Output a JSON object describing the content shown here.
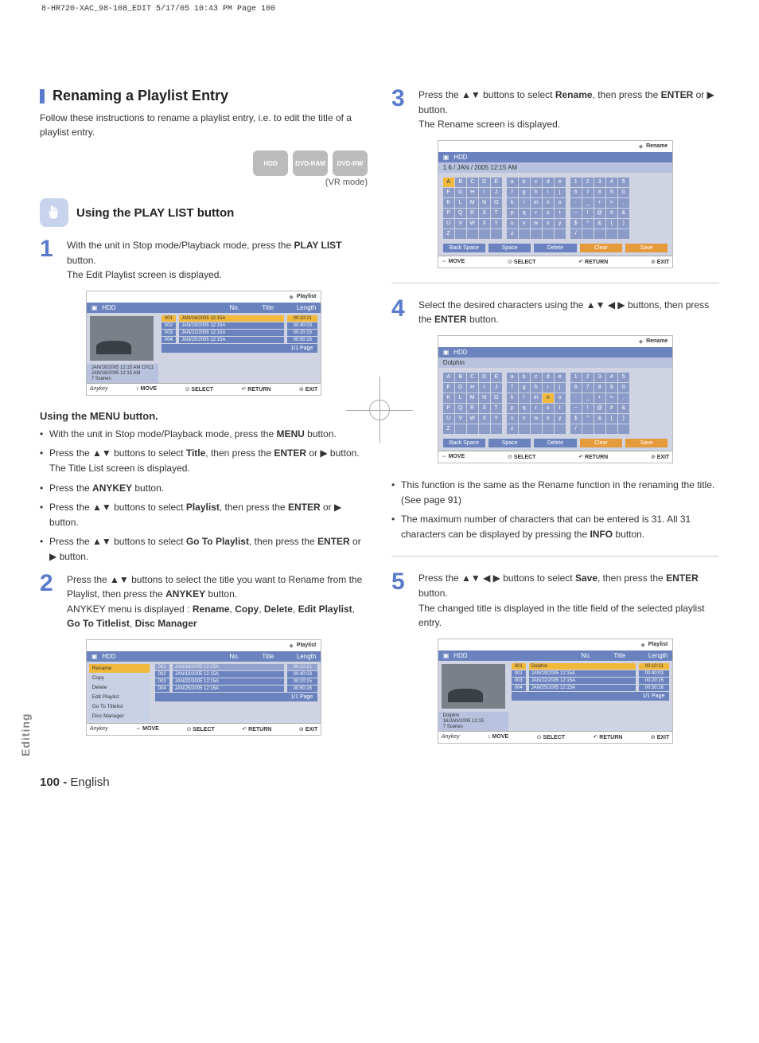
{
  "print_header": "8-HR720-XAC_98-108_EDIT  5/17/05  10:43 PM  Page 100",
  "vtab": "Editing",
  "page_number_label": "100 - ",
  "page_language": "English",
  "section": {
    "title": "Renaming a Playlist Entry"
  },
  "intro": "Follow these instructions to rename a playlist entry, i.e. to edit the title of a playlist entry.",
  "media_icons": {
    "a": "HDD",
    "b": "DVD-RAM",
    "c": "DVD-RW"
  },
  "vr_mode": "(VR mode)",
  "sub1": {
    "title": "Using the PLAY LIST button"
  },
  "step1": {
    "line1": "With the unit in Stop mode/Playback mode, press the ",
    "bold1": "PLAY LIST",
    "line1b": " button.",
    "line2": "The Edit Playlist screen is displayed."
  },
  "ss1": {
    "toplabel": "Playlist",
    "hdd": "HDD",
    "cols": {
      "no": "No.",
      "title": "Title",
      "length": "Length"
    },
    "rows": [
      {
        "n": "001",
        "t": "JAN/16/2005 12:15A",
        "l": "00:10:21"
      },
      {
        "n": "002",
        "t": "JAN/19/2005 12:15A",
        "l": "00:40:03"
      },
      {
        "n": "003",
        "t": "JAN/22/2005 12:15A",
        "l": "00:20:15"
      },
      {
        "n": "004",
        "t": "JAN/25/2005 12:15A",
        "l": "00:50:16"
      }
    ],
    "meta1": "JAN/16/2005 12:15 AM CH11",
    "meta2": "JAN/16/2005 12:15 AM",
    "meta3": "7 Scenes",
    "page": "1/1 Page",
    "anykey": "Anykey",
    "foot": {
      "move": "MOVE",
      "select": "SELECT",
      "return": "RETURN",
      "exit": "EXIT"
    }
  },
  "menu_section": {
    "title": "Using the MENU button.",
    "b1a": "With the unit in Stop mode/Playback mode, press the ",
    "b1b": "MENU",
    "b1c": " button.",
    "b2a": "Press the ▲▼ buttons to select ",
    "b2b": "Title",
    "b2c": ", then press the ",
    "b2d": "ENTER",
    "b2e": " or ▶ button. The Title List screen is displayed.",
    "b3a": "Press the ",
    "b3b": "ANYKEY",
    "b3c": " button.",
    "b4a": "Press the ▲▼ buttons to select ",
    "b4b": "Playlist",
    "b4c": ", then press the ",
    "b4d": "ENTER",
    "b4e": " or ▶ button.",
    "b5a": "Press the ▲▼ buttons to select ",
    "b5b": "Go To Playlist",
    "b5c": ", then press the ",
    "b5d": "ENTER",
    "b5e": " or ▶ button."
  },
  "step2": {
    "l1": "Press the ▲▼ buttons to select the title you want to Rename from the Playlist, then press the ",
    "b1": "ANYKEY",
    "l1b": " button.",
    "l2a": "ANYKEY menu is displayed : ",
    "m1": "Rename",
    "m2": "Copy",
    "m3": "Delete",
    "m4": "Edit Playlist",
    "m5": "Go To Titlelist",
    "m6": "Disc Manager"
  },
  "ss2": {
    "toplabel": "Playlist",
    "hdd": "HDD",
    "menu": [
      "Rename",
      "Copy",
      "Delete",
      "Edit Playlist",
      "Go To Titlelist",
      "Disc Manager"
    ],
    "page": "1/1 Page"
  },
  "step3": {
    "l1": "Press the  ▲▼ buttons to select ",
    "b1": "Rename",
    "l1b": ", then press the ",
    "b2": "ENTER",
    "l1c": " or ▶ button.",
    "l2": "The Rename screen is displayed."
  },
  "ss3": {
    "toplabel": "Rename",
    "hdd": "HDD",
    "title": "1 6 / JAN / 2005 12:15 AM",
    "backspace": "Back Space",
    "space": "Space",
    "delete": "Delete",
    "clear": "Clear",
    "save": "Save"
  },
  "step4": {
    "l1": "Select the desired characters using the ▲▼ ◀ ▶ buttons, then press the ",
    "b1": "ENTER",
    "l1b": " button."
  },
  "ss4": {
    "toplabel": "Rename",
    "hdd": "HDD",
    "title": "Dolphin"
  },
  "notes": {
    "n1": "This function is the same as the Rename function in the renaming the title. (See page 91)",
    "n2a": "The maximum number of characters that can be entered is 31. All 31 characters can be displayed by pressing the ",
    "n2b": "INFO",
    "n2c": " button."
  },
  "step5": {
    "l1": "Press the ▲▼ ◀ ▶ buttons to select ",
    "b1": "Save",
    "l1b": ", then press the ",
    "b2": "ENTER",
    "l1c": " button.",
    "l2": "The changed title is displayed in the title field of the selected playlist entry."
  },
  "ss5": {
    "toplabel": "Playlist",
    "hdd": "HDD",
    "rows": [
      {
        "n": "001",
        "t": "Dolphin",
        "l": "00:10:21"
      },
      {
        "n": "002",
        "t": "JAN/19/2005 12:15A",
        "l": "00:40:03"
      },
      {
        "n": "003",
        "t": "JAN/22/2005 12:15A",
        "l": "00:20:15"
      },
      {
        "n": "004",
        "t": "JAN/25/2005 12:15A",
        "l": "00:50:16"
      }
    ],
    "meta1": "Dolphin",
    "meta2": "16/JAN/2005 12:15",
    "meta3": "7 Scenes",
    "page": "1/1 Page"
  }
}
